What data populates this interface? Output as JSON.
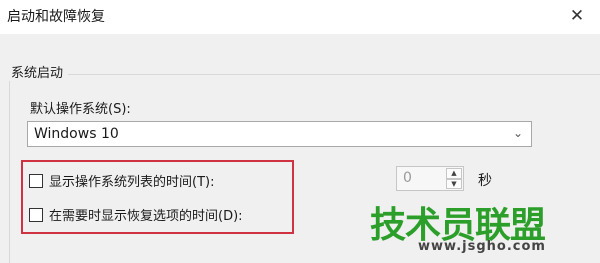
{
  "window": {
    "title": "启动和故障恢复",
    "close_glyph": "✕"
  },
  "system_startup": {
    "group_label": "系统启动",
    "default_os_label": "默认操作系统(S):",
    "default_os_value": "Windows 10",
    "show_os_list": {
      "label": "显示操作系统列表的时间(T):",
      "checked": false,
      "value": "0",
      "unit": "秒"
    },
    "show_recovery": {
      "label": "在需要时显示恢复选项的时间(D):",
      "checked": false
    }
  },
  "highlight_color": "#cf3342",
  "watermark": {
    "text": "技术员联盟",
    "url": "www.jsgho.com",
    "color": "#2c9f2a"
  }
}
